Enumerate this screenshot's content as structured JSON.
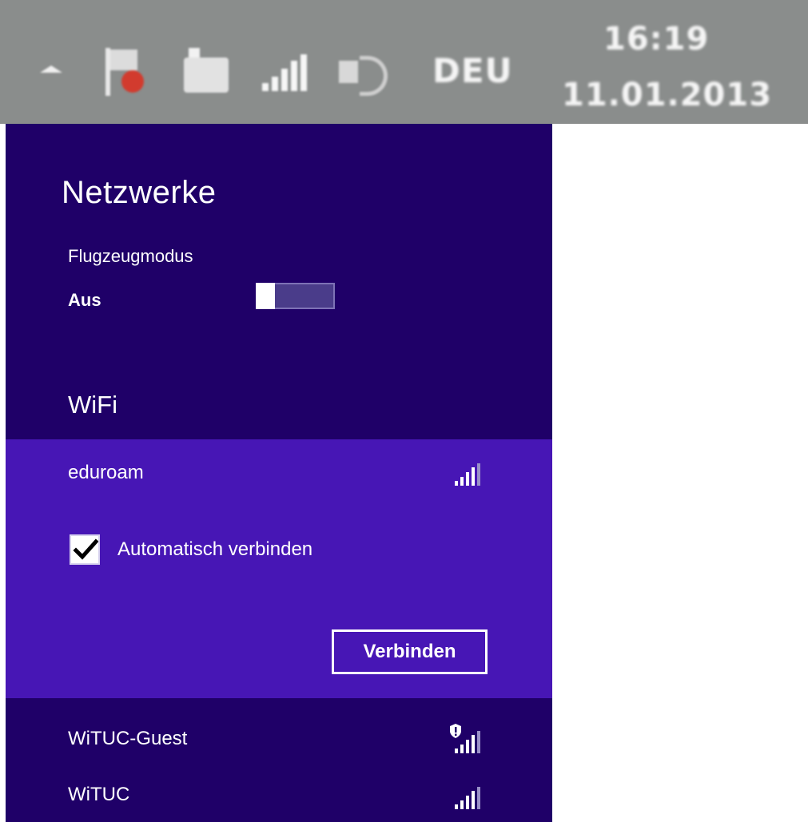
{
  "tray": {
    "language": "DEU",
    "time": "16:19",
    "date": "11.01.2013",
    "icons": [
      "show-hidden-icons-arrow",
      "action-center-flag-icon",
      "battery-icon",
      "network-signal-icon",
      "speaker-icon"
    ]
  },
  "panel": {
    "title": "Netzwerke",
    "airplane_mode": {
      "label": "Flugzeugmodus",
      "state": "Aus",
      "on": false
    },
    "wifi_heading": "WiFi",
    "selected_network": {
      "name": "eduroam",
      "signal_bars": 5,
      "auto_connect_label": "Automatisch verbinden",
      "auto_connect_checked": true,
      "connect_label": "Verbinden"
    },
    "networks": [
      {
        "name": "WiTUC-Guest",
        "signal_bars": 5,
        "security_warning": true
      },
      {
        "name": "WiTUC",
        "signal_bars": 5,
        "security_warning": false
      }
    ]
  },
  "colors": {
    "panel_bg": "#1f0068",
    "selected_bg": "#4716b5",
    "tray_bg": "#8a8d8c"
  }
}
